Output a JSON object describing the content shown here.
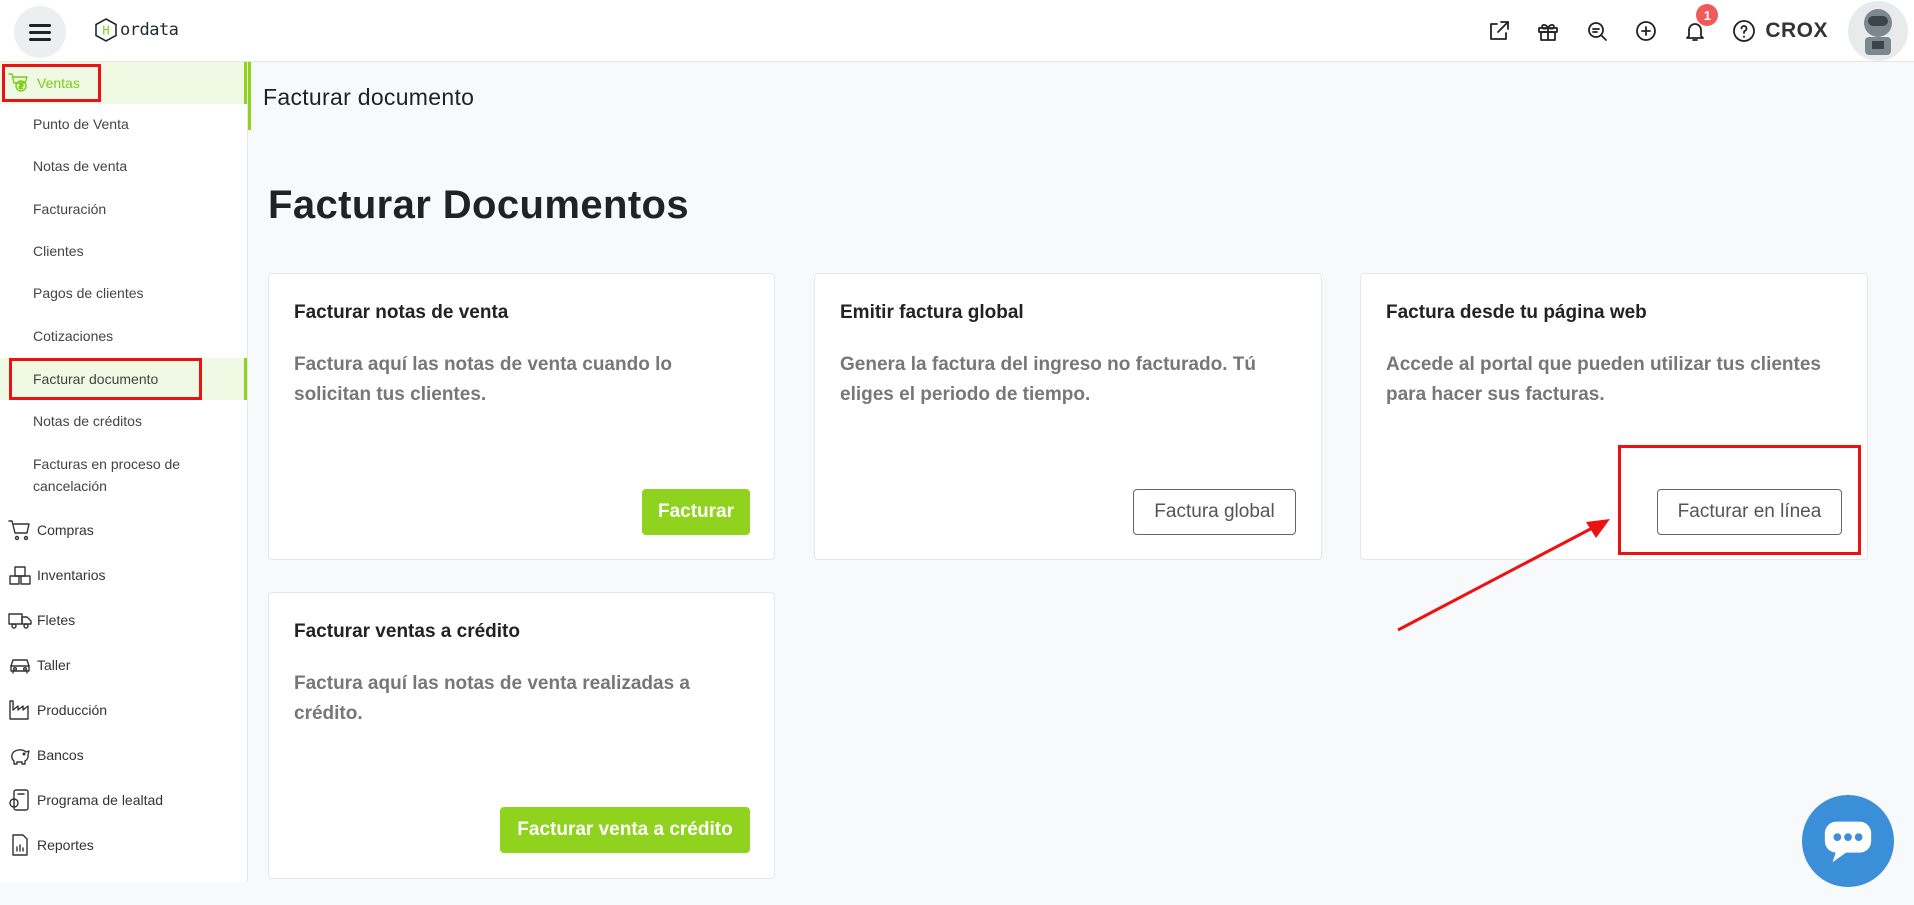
{
  "app": {
    "logo_text": "ordata",
    "logo_letter": "H"
  },
  "topbar": {
    "notification_count": "1",
    "user_name": "CROX"
  },
  "sidebar": {
    "ventas": "Ventas",
    "ventas_items": [
      "Punto de Venta",
      "Notas de venta",
      "Facturación",
      "Clientes",
      "Pagos de clientes",
      "Cotizaciones",
      "Facturar documento",
      "Notas de créditos",
      "Facturas en proceso de cancelación"
    ],
    "sections": [
      "Compras",
      "Inventarios",
      "Fletes",
      "Taller",
      "Producción",
      "Bancos",
      "Programa de lealtad",
      "Reportes"
    ]
  },
  "page": {
    "header": "Facturar documento",
    "title": "Facturar Documentos"
  },
  "cards": [
    {
      "title": "Facturar notas de venta",
      "desc": "Factura aquí las notas de venta cuando lo solicitan tus clientes.",
      "button": "Facturar"
    },
    {
      "title": "Emitir factura global",
      "desc": "Genera la factura del ingreso no facturado. Tú eliges el periodo de tiempo.",
      "button": "Factura global"
    },
    {
      "title": "Factura desde tu página web",
      "desc": "Accede al portal que pueden utilizar tus clientes para hacer sus facturas.",
      "button": "Facturar en línea"
    },
    {
      "title": "Facturar ventas a crédito",
      "desc": "Factura aquí las notas de venta realizadas a crédito.",
      "button": "Facturar venta a crédito"
    }
  ],
  "colors": {
    "accent": "#8fd31f",
    "annotation": "#ee1111",
    "chat": "#3b8ed8"
  }
}
